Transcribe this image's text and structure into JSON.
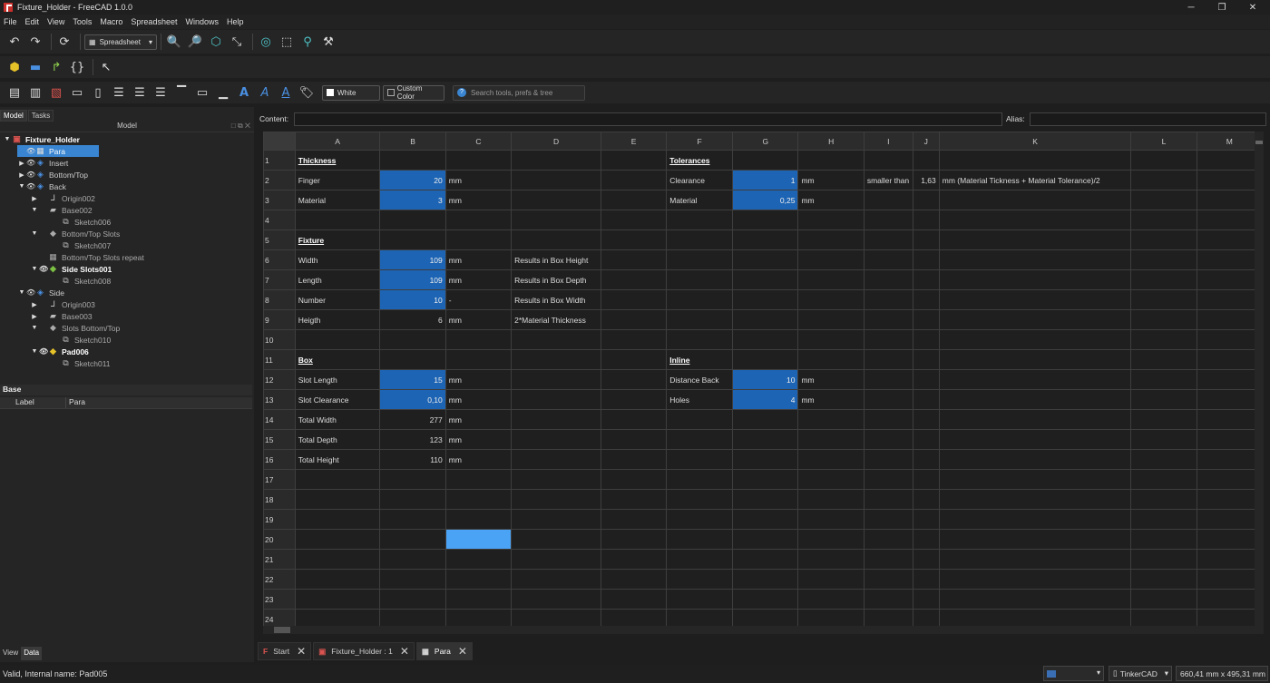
{
  "window": {
    "title": "Fixture_Holder - FreeCAD 1.0.0",
    "minimize": "─",
    "maximize": "❐",
    "close": "✕"
  },
  "menu": [
    "File",
    "Edit",
    "View",
    "Tools",
    "Macro",
    "Spreadsheet",
    "Windows",
    "Help"
  ],
  "toolbar": {
    "workbench": "Spreadsheet",
    "white_label": "White",
    "custom_color_label": "Custom Color",
    "search_placeholder": "Search tools, prefs & tree"
  },
  "left": {
    "tabs": [
      "Model",
      "Tasks"
    ],
    "tree_header": "Model",
    "tree": [
      {
        "label": "Fixture_Holder",
        "icon": "document-icon",
        "arrow": "▼",
        "eye": "",
        "bold": true
      },
      {
        "label": "Para",
        "icon": "spreadsheet-icon",
        "arrow": "",
        "eye": "👁",
        "selected": true
      },
      {
        "label": "Insert",
        "icon": "body-icon",
        "arrow": "▶",
        "eye": "👁"
      },
      {
        "label": "Bottom/Top",
        "icon": "body-icon",
        "arrow": "▶",
        "eye": "👁"
      },
      {
        "label": "Back",
        "icon": "body-icon",
        "arrow": "▼",
        "eye": "👁"
      },
      {
        "label": "Origin002",
        "icon": "origin-icon",
        "arrow": "▶",
        "eye": "⊘",
        "dim": true
      },
      {
        "label": "Base002",
        "icon": "pad-icon",
        "arrow": "▼",
        "eye": "⊘",
        "dim": true
      },
      {
        "label": "Sketch006",
        "icon": "sketch-icon",
        "arrow": "",
        "eye": "⊘",
        "dim": true
      },
      {
        "label": "Bottom/Top Slots",
        "icon": "pocket-icon",
        "arrow": "▼",
        "eye": "⊘",
        "dim": true
      },
      {
        "label": "Sketch007",
        "icon": "sketch-icon",
        "arrow": "",
        "eye": "⊘",
        "dim": true
      },
      {
        "label": "Bottom/Top Slots repeat",
        "icon": "pattern-icon",
        "arrow": "",
        "eye": "⊘",
        "dim": true
      },
      {
        "label": "Side Slots001",
        "icon": "pocket-tip-icon",
        "arrow": "▼",
        "eye": "👁",
        "bold": true
      },
      {
        "label": "Sketch008",
        "icon": "sketch-icon",
        "arrow": "",
        "eye": "⊘",
        "dim": true
      },
      {
        "label": "Side",
        "icon": "body-icon",
        "arrow": "▼",
        "eye": "👁"
      },
      {
        "label": "Origin003",
        "icon": "origin-icon",
        "arrow": "▶",
        "eye": "⊘",
        "dim": true
      },
      {
        "label": "Base003",
        "icon": "pad-icon",
        "arrow": "▶",
        "eye": "⊘",
        "dim": true
      },
      {
        "label": "Slots Bottom/Top",
        "icon": "pocket-icon",
        "arrow": "▼",
        "eye": "⊘",
        "dim": true
      },
      {
        "label": "Sketch010",
        "icon": "sketch-icon",
        "arrow": "",
        "eye": "⊘",
        "dim": true
      },
      {
        "label": "Pad006",
        "icon": "pad-tip-icon",
        "arrow": "▼",
        "eye": "👁",
        "bold": true
      },
      {
        "label": "Sketch011",
        "icon": "sketch-icon",
        "arrow": "",
        "eye": "⊘",
        "dim": true
      }
    ],
    "prop_group": "Base",
    "prop_cols": [
      "Label",
      "Para"
    ],
    "bottom_tabs": [
      "View",
      "Data"
    ]
  },
  "content": {
    "label": "Content:",
    "alias_label": "Alias:",
    "value": "",
    "alias": ""
  },
  "sheet": {
    "columns": [
      "A",
      "B",
      "C",
      "D",
      "E",
      "F",
      "G",
      "H",
      "I",
      "J",
      "K",
      "L",
      "M"
    ],
    "rows": [
      [
        "Thickness",
        "",
        "",
        "",
        "",
        "Tolerances",
        "",
        "",
        "",
        "",
        "",
        "",
        ""
      ],
      [
        "Finger",
        "20",
        "mm",
        "",
        "",
        "Clearance",
        "1",
        "mm",
        "smaller than",
        "1,63",
        "mm  (Material Tickness + Material Tolerance)/2",
        "",
        ""
      ],
      [
        "Material",
        "3",
        "mm",
        "",
        "",
        "Material",
        "0,25",
        "mm",
        "",
        "",
        "",
        "",
        ""
      ],
      [
        "",
        "",
        "",
        "",
        "",
        "",
        "",
        "",
        "",
        "",
        "",
        "",
        ""
      ],
      [
        "Fixture",
        "",
        "",
        "",
        "",
        "",
        "",
        "",
        "",
        "",
        "",
        "",
        ""
      ],
      [
        "Width",
        "109",
        "mm",
        "Results in Box Height",
        "",
        "",
        "",
        "",
        "",
        "",
        "",
        "",
        ""
      ],
      [
        "Length",
        "109",
        "mm",
        "Results in Box Depth",
        "",
        "",
        "",
        "",
        "",
        "",
        "",
        "",
        ""
      ],
      [
        "Number",
        "10",
        "-",
        "Results in Box Width",
        "",
        "",
        "",
        "",
        "",
        "",
        "",
        "",
        ""
      ],
      [
        "Heigth",
        "6",
        "mm",
        "2*Material Thickness",
        "",
        "",
        "",
        "",
        "",
        "",
        "",
        "",
        ""
      ],
      [
        "",
        "",
        "",
        "",
        "",
        "",
        "",
        "",
        "",
        "",
        "",
        "",
        ""
      ],
      [
        "Box",
        "",
        "",
        "",
        "",
        "Inline",
        "",
        "",
        "",
        "",
        "",
        "",
        ""
      ],
      [
        "Slot Length",
        "15",
        "mm",
        "",
        "",
        "Distance Back",
        "10",
        "mm",
        "",
        "",
        "",
        "",
        ""
      ],
      [
        "Slot Clearance",
        "0,10",
        "mm",
        "",
        "",
        "Holes",
        "4",
        "mm",
        "",
        "",
        "",
        "",
        ""
      ],
      [
        "Total Width",
        "277",
        "mm",
        "",
        "",
        "",
        "",
        "",
        "",
        "",
        "",
        "",
        ""
      ],
      [
        "Total Depth",
        "123",
        "mm",
        "",
        "",
        "",
        "",
        "",
        "",
        "",
        "",
        "",
        ""
      ],
      [
        "Total Height",
        "110",
        "mm",
        "",
        "",
        "",
        "",
        "",
        "",
        "",
        "",
        "",
        ""
      ],
      [
        "",
        "",
        "",
        "",
        "",
        "",
        "",
        "",
        "",
        "",
        "",
        "",
        ""
      ],
      [
        "",
        "",
        "",
        "",
        "",
        "",
        "",
        "",
        "",
        "",
        "",
        "",
        ""
      ],
      [
        "",
        "",
        "",
        "",
        "",
        "",
        "",
        "",
        "",
        "",
        "",
        "",
        ""
      ],
      [
        "",
        "",
        "",
        "",
        "",
        "",
        "",
        "",
        "",
        "",
        "",
        "",
        ""
      ],
      [
        "",
        "",
        "",
        "",
        "",
        "",
        "",
        "",
        "",
        "",
        "",
        "",
        ""
      ],
      [
        "",
        "",
        "",
        "",
        "",
        "",
        "",
        "",
        "",
        "",
        "",
        "",
        ""
      ],
      [
        "",
        "",
        "",
        "",
        "",
        "",
        "",
        "",
        "",
        "",
        "",
        "",
        ""
      ],
      [
        "",
        "",
        "",
        "",
        "",
        "",
        "",
        "",
        "",
        "",
        "",
        "",
        ""
      ]
    ],
    "headers": [
      "Thickness",
      "Tolerances",
      "Fixture",
      "Box",
      "Inline"
    ],
    "blue_cells": [
      "B2",
      "B3",
      "B6",
      "B7",
      "B8",
      "B12",
      "B13",
      "G2",
      "G3",
      "G12",
      "G13"
    ],
    "selected_cell": "C20"
  },
  "doc_tabs": [
    {
      "label": "Start",
      "icon": "freecad-icon"
    },
    {
      "label": "Fixture_Holder : 1",
      "icon": "document-icon"
    },
    {
      "label": "Para",
      "icon": "spreadsheet-icon",
      "active": true
    }
  ],
  "status": {
    "message": "Valid, Internal name: Pad005",
    "nav_style": "TinkerCAD",
    "dimensions": "660,41 mm x 495,31 mm"
  },
  "colors": {
    "selection": "#3a85d1",
    "input_cell": "#1d64b4",
    "selected_cell": "#4aa3f5"
  }
}
